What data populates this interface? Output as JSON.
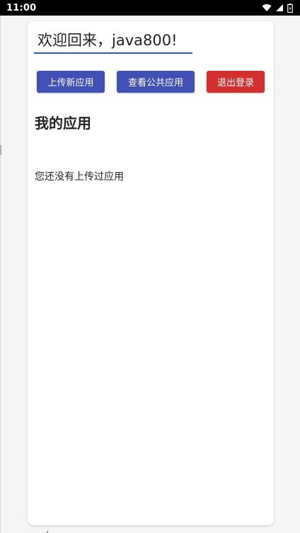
{
  "status_bar": {
    "time": "11:00",
    "icons": [
      "wifi-icon",
      "cellular-signal-icon",
      "battery-icon"
    ]
  },
  "header": {
    "welcome_text": "欢迎回来，java800!"
  },
  "toolbar": {
    "upload_label": "上传新应用",
    "public_apps_label": "查看公共应用",
    "logout_label": "退出登录"
  },
  "my_apps": {
    "title": "我的应用",
    "empty_message": "您还没有上传过应用"
  },
  "colors": {
    "primary": "#3f51b5",
    "danger": "#d32f2f",
    "background": "#f5f5f5",
    "card": "#ffffff"
  }
}
